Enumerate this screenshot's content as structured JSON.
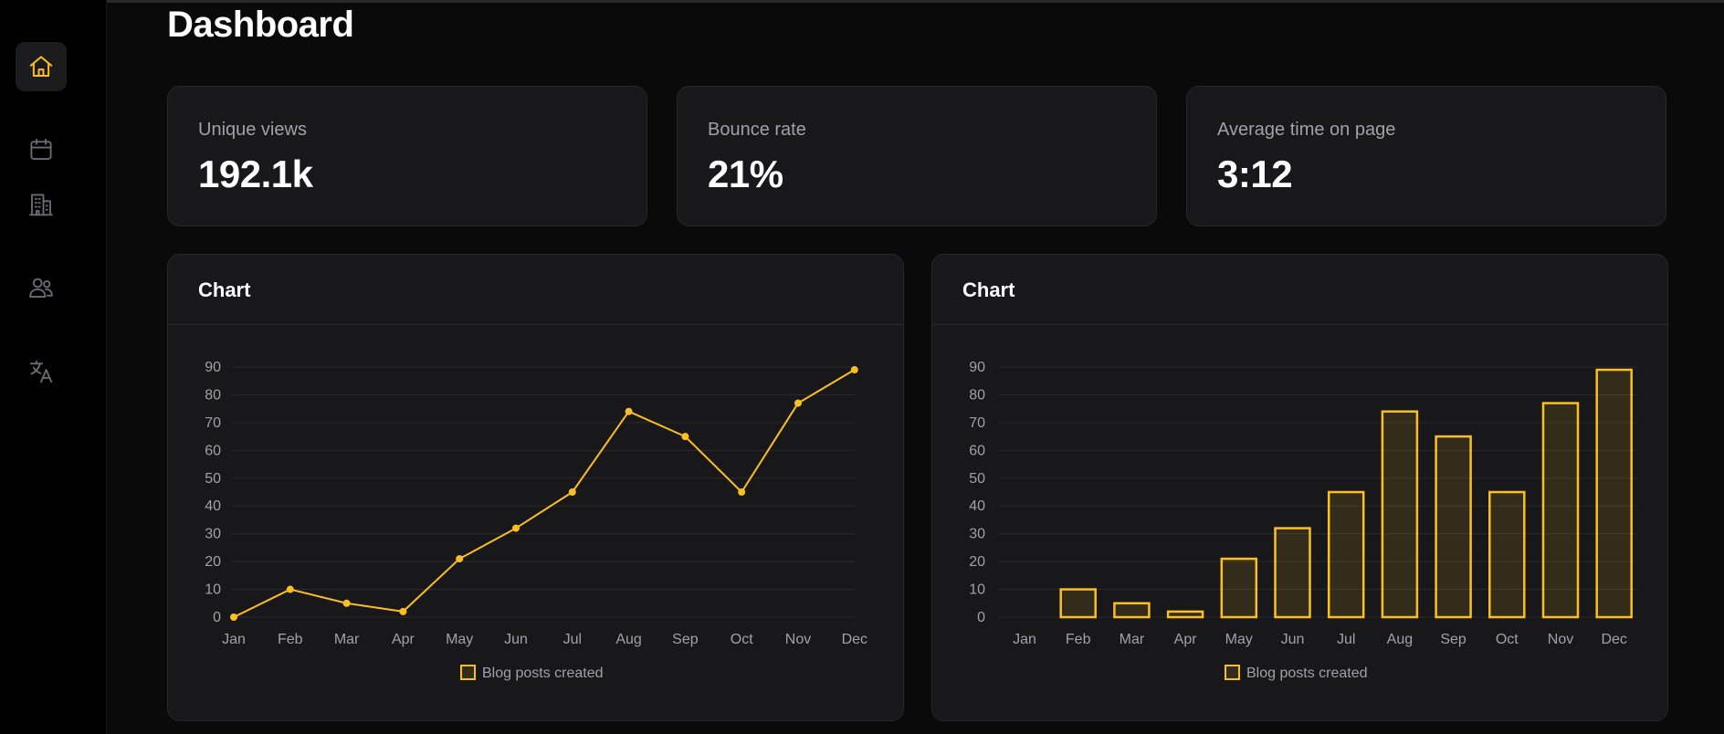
{
  "colors": {
    "accent": "#fbbf24",
    "card_bg": "#18181a",
    "border": "#27272a",
    "muted_text": "#a1a1aa",
    "grid": "#2a2a2e"
  },
  "sidebar": {
    "items": [
      {
        "icon": "home-icon",
        "active": true
      },
      {
        "icon": "calendar-icon",
        "active": false
      },
      {
        "icon": "building-icon",
        "active": false
      },
      {
        "icon": "users-icon",
        "active": false
      },
      {
        "icon": "translate-icon",
        "active": false
      }
    ]
  },
  "page": {
    "title": "Dashboard"
  },
  "stats": [
    {
      "label": "Unique views",
      "value": "192.1k"
    },
    {
      "label": "Bounce rate",
      "value": "21%"
    },
    {
      "label": "Average time on page",
      "value": "3:12"
    }
  ],
  "cards": [
    {
      "title": "Chart"
    },
    {
      "title": "Chart"
    }
  ],
  "chart_data": [
    {
      "type": "line",
      "categories": [
        "Jan",
        "Feb",
        "Mar",
        "Apr",
        "May",
        "Jun",
        "Jul",
        "Aug",
        "Sep",
        "Oct",
        "Nov",
        "Dec"
      ],
      "series": [
        {
          "name": "Blog posts created",
          "values": [
            0,
            10,
            5,
            2,
            21,
            32,
            45,
            74,
            65,
            45,
            77,
            89
          ]
        }
      ],
      "ylim": [
        0,
        90
      ],
      "yticks": [
        0,
        10,
        20,
        30,
        40,
        50,
        60,
        70,
        80,
        90
      ],
      "grid": true,
      "legend": "bottom-center"
    },
    {
      "type": "bar",
      "categories": [
        "Jan",
        "Feb",
        "Mar",
        "Apr",
        "May",
        "Jun",
        "Jul",
        "Aug",
        "Sep",
        "Oct",
        "Nov",
        "Dec"
      ],
      "series": [
        {
          "name": "Blog posts created",
          "values": [
            0,
            10,
            5,
            2,
            21,
            32,
            45,
            74,
            65,
            45,
            77,
            89
          ]
        }
      ],
      "ylim": [
        0,
        90
      ],
      "yticks": [
        0,
        10,
        20,
        30,
        40,
        50,
        60,
        70,
        80,
        90
      ],
      "grid": true,
      "legend": "bottom-center"
    }
  ]
}
